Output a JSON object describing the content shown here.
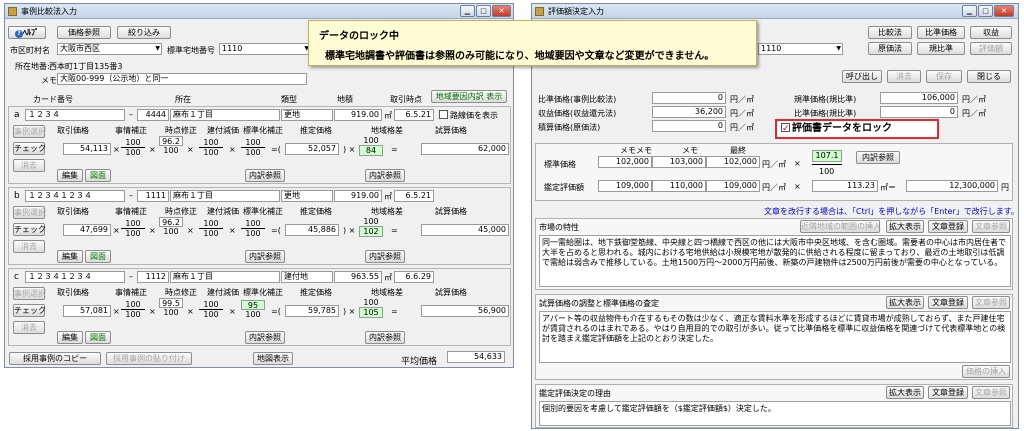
{
  "left": {
    "title": "事例比較法入力",
    "help": "ﾍﾙﾌﾟ",
    "btn_ref": "価格参照",
    "btn_filter": "絞り込み",
    "city_label": "市区町村名",
    "city_value": "大阪市西区",
    "std_label": "標準宅地番号",
    "std_value": "1110",
    "addr_label": "所在地番:",
    "addr_value": "西本町1丁目135番3",
    "memo_label": "メモ",
    "memo_value": "大阪00-999（公示地）と同一",
    "head": {
      "card": "カード番号",
      "loc": "所在",
      "type": "類型",
      "area": "地積",
      "time": "取引時点",
      "region_btn": "地域要因内訳 表示"
    },
    "col": {
      "price": "取引価格",
      "adj": "事情補正",
      "time": "時点修正",
      "build": "建付減価",
      "std": "標準化補正",
      "est": "推定価格",
      "region": "地域格差",
      "trial": "試算価格"
    },
    "btn_select": "事例選択",
    "btn_check": "チェック",
    "btn_delete": "消去",
    "btn_edit": "編集",
    "btn_map": "図面",
    "btn_detail": "内訳参照",
    "m2": "㎡",
    "exclude_label": "路線価を表示",
    "cases": [
      {
        "letter": "a",
        "card": "１２３４",
        "no": "4444",
        "loc": "麻布１丁目",
        "type": "更地",
        "area": "919.00",
        "time": "6.5.21",
        "price": "54,113",
        "adj": "100",
        "tm": "96.2",
        "bld": "100",
        "std": "100",
        "est": "52,057",
        "reg": "84",
        "trial": "62,000"
      },
      {
        "letter": "b",
        "card": "１２３４１２３４",
        "no": "1111",
        "loc": "麻布１丁目",
        "type": "更地",
        "area": "919.00",
        "time": "6.5.21",
        "price": "47,699",
        "adj": "100",
        "tm": "96.2",
        "bld": "100",
        "std": "100",
        "est": "45,886",
        "reg": "102",
        "trial": "45,000"
      },
      {
        "letter": "c",
        "card": "１２３４１２３４",
        "no": "1112",
        "loc": "麻布１丁目",
        "type": "建付地",
        "area": "963.55",
        "time": "6.6.29",
        "price": "57,081",
        "adj": "100",
        "tm": "99.5",
        "bld": "100",
        "std": "95",
        "est": "59,785",
        "reg": "105",
        "trial": "56,900"
      }
    ],
    "btn_copy": "採用事例のコピー",
    "btn_paste": "採用事例の貼り付け",
    "btn_mapview": "地図表示",
    "avg_label": "平均価格",
    "avg_value": "54,633"
  },
  "banner": {
    "title": "データのロック中",
    "body": "標準宅地調書や評価書は参照のみ可能になり、地域要因や文章など変更ができません。"
  },
  "right": {
    "title": "評価額決定入力",
    "btns": [
      "比較法",
      "比準価格",
      "収益",
      "原価法",
      "規比準",
      "評価額"
    ],
    "std_value": "1110",
    "btn_call": "呼び出し",
    "btn_clear": "消去",
    "btn_save": "保存",
    "btn_close": "閉じる",
    "rows": [
      {
        "label": "比準価格(事例比較法)",
        "value": "0",
        "unit": "円／㎡"
      },
      {
        "label": "収益価格(収益還元法)",
        "value": "36,200",
        "unit": "円／㎡"
      },
      {
        "label": "積算価格(原価法)",
        "value": "0",
        "unit": "円／㎡"
      }
    ],
    "rows2": [
      {
        "label": "規準価格(規比準)",
        "value": "106,000",
        "unit": "円／㎡"
      },
      {
        "label": "比準価格(規比準)",
        "value": "0",
        "unit": "円／㎡"
      }
    ],
    "lock_label": "評価書データをロック",
    "calc": {
      "h_memo": "メモメモ",
      "h_memo2": "メモ",
      "h_final": "最終",
      "std_label": "標準価格",
      "std_v1": "102,000",
      "std_v2": "103,000",
      "std_v3": "102,000",
      "frac_top": "107.1",
      "frac_bottom": "100",
      "btn_detail": "内訳参照",
      "eval_label": "鑑定評価額",
      "ev1": "109,000",
      "ev2": "110,000",
      "ev3": "109,000",
      "m2v": "113.23",
      "m2eq": "㎡＝",
      "total": "12,300,000",
      "yen": "円",
      "unit": "円／㎡",
      "times": "×"
    },
    "hint": "文章を改行する場合は、「Ctrl」を押しながら「Enter」で改行します。",
    "s1": {
      "title": "市場の特性",
      "btn_near": "近隣地域の範囲の挿入",
      "text": "同一需給圏は、地下鉄御堂筋線、中央線と四つ橋線で西区の他には大阪市中央区地域、を含む圏域。需要者の中心は市内居住者で大半を占めると思われる。城内における宅地供給は小規模宅地が散発的に供給される程度に留まっており、最近の土地取引は低調で需給は弱含みで推移している。土地1500万円〜2000万円前後、新築の戸建物件は2500万円前後が需要の中心となっている。"
    },
    "s2": {
      "title": "試算価格の調整と標準価格の査定",
      "text": "アパート等の収益物件も介在するもその数は少なく、適正な賃料水準を形成するほどに賃貸市場が成熟しておらず、また戸建住宅が賃貸されるのはまれである。やはり自用目的での取引が多い。従って比準価格を標準に収益価格を関連づけて代表標準地との検討を踏まえ鑑定評価額を上記のとおり決定した。",
      "btn_insert": "価格の挿入"
    },
    "s3": {
      "title": "鑑定評価決定の理由",
      "text": "個別的要因を考慮して鑑定評価額を（$鑑定評価額$）決定した。"
    },
    "btn_zoom": "拡大表示",
    "btn_doc": "文章登録",
    "btn_docref": "文章参照"
  }
}
